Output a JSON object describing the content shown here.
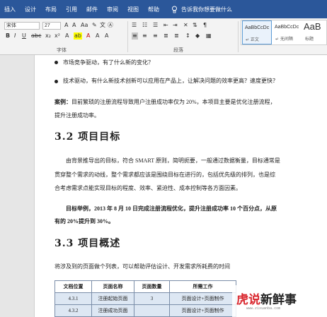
{
  "tabs": [
    "插入",
    "设计",
    "布局",
    "引用",
    "邮件",
    "审阅",
    "视图",
    "帮助"
  ],
  "tell_me": "告诉我你想要做什么",
  "ribbon": {
    "font_name": "宋体",
    "font_size": "27",
    "group_font": "字体",
    "group_paragraph": "段落",
    "styles": [
      {
        "sample": "AaBbCcDc",
        "name": "↵ 正文"
      },
      {
        "sample": "AaBbCcDc",
        "name": "↵ 无间隔"
      },
      {
        "sample": "AaB",
        "name": "标题"
      }
    ]
  },
  "doc": {
    "bullet1": "市场竞争驱动，有了什么新的变化？",
    "bullet2": "技术驱动，有什么新技术创新可以应用在产品上，让解决问题的效率更高？速度更快？",
    "case_label": "案例：",
    "case_text": "目前繁琐的注册流程导致用户注册成功率仅为 20%，本项目主要是优化注册流程，",
    "case_text2": "提升注册成功率。",
    "h_goal": "3.2 项目目标",
    "goal_p1": "由背景推导出的目标，符合 SMART 原则，简明扼要，一般通过数据衡量，目标通常是",
    "goal_p2": "贯穿整个需求的动线，整个需求都应该是围绕目标在进行的，包括优先级的排列，也是综",
    "goal_p3": "合考虑需求点能实现目标的程度、效率、紧迫性、成本控制等各方面因素。",
    "goal_ex1": "目标举例，2013 年 8 月 10 日完成注册流程优化，提升注册成功率 10 个百分点，从原",
    "goal_ex2": "有的 20%提升到 30%。",
    "h_overview": "3.3 项目概述",
    "overview_p": "将涉及到的页面做个列表，可以帮助评估设计、开发需求所耗费的时间",
    "table": {
      "headers": [
        "文档位置",
        "页面名称",
        "页面数量",
        "所需工作"
      ],
      "rows": [
        [
          "4.3.1",
          "注册起始页面",
          "3",
          "页面设计+页面制作"
        ],
        [
          "4.3.2",
          "注册成功页面",
          "",
          "页面设计+页面制作"
        ]
      ]
    }
  },
  "watermark": {
    "brand_red": "虎说",
    "brand_black": "新鲜事",
    "url": "www.zixuanba.com"
  },
  "colors": {
    "tabbar": "#2b579a",
    "table_fill": "#dde7f3",
    "watermark_red": "#d9272e"
  }
}
